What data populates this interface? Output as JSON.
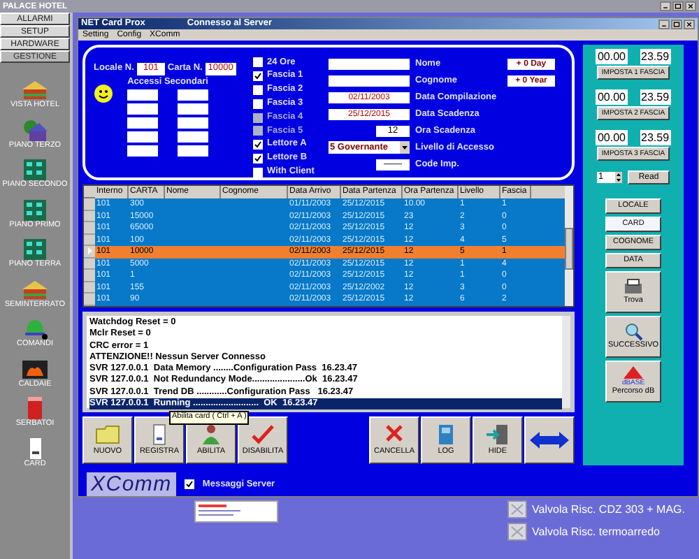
{
  "app_title": "PALACE HOTEL",
  "sidebar": {
    "tabs": [
      {
        "label": "ALLARMI",
        "selected": false
      },
      {
        "label": "SETUP",
        "selected": false
      },
      {
        "label": "HARDWARE",
        "selected": false
      },
      {
        "label": "GESTIONE",
        "selected": true
      }
    ],
    "items": [
      {
        "label": "VISTA HOTEL",
        "kind": "hotel"
      },
      {
        "label": "PIANO TERZO",
        "kind": "house"
      },
      {
        "label": "PIANO SECONDO",
        "kind": "building"
      },
      {
        "label": "PIANO PRIMO",
        "kind": "building"
      },
      {
        "label": "PIANO TERRA",
        "kind": "building"
      },
      {
        "label": "SEMINTERRATO",
        "kind": "hotel"
      },
      {
        "label": "COMANDI",
        "kind": "bell"
      },
      {
        "label": "CALDAIE",
        "kind": "fire"
      },
      {
        "label": "SERBATOI",
        "kind": "tank"
      },
      {
        "label": "CARD",
        "kind": "card"
      }
    ]
  },
  "window": {
    "title": "NET Card Prox",
    "status": "Connesso al Server",
    "menu": [
      "Setting",
      "Config",
      "XComm"
    ]
  },
  "form": {
    "locale_label": "Locale N.",
    "locale": "101",
    "carta_label": "Carta N.",
    "carta": "10000",
    "accessi_label": "Accessi Secondari",
    "checkboxes": [
      {
        "label": "24 Ore",
        "checked": false,
        "disabled": false
      },
      {
        "label": "Fascia 1",
        "checked": true,
        "disabled": false
      },
      {
        "label": "Fascia 2",
        "checked": false,
        "disabled": false
      },
      {
        "label": "Fascia 3",
        "checked": false,
        "disabled": false
      },
      {
        "label": "Fascia 4",
        "checked": false,
        "disabled": true
      },
      {
        "label": "Fascia 5",
        "checked": false,
        "disabled": true
      },
      {
        "label": "Lettore A",
        "checked": true,
        "disabled": false
      },
      {
        "label": "Lettore B",
        "checked": true,
        "disabled": false
      },
      {
        "label": "With Client",
        "checked": false,
        "disabled": false
      }
    ],
    "fields": [
      {
        "label": "Nome",
        "kind": "text",
        "button": "+ 0 Day"
      },
      {
        "label": "Cognome",
        "kind": "text",
        "button": "+ 0 Year"
      },
      {
        "label": "Data Compilazione",
        "kind": "text",
        "value": "02/11/2003"
      },
      {
        "label": "Data Scadenza",
        "kind": "text",
        "value": "25/12/2015"
      },
      {
        "label": "Ora Scadenza",
        "kind": "short",
        "value": "12"
      },
      {
        "label": "Livello di Accesso",
        "kind": "select",
        "value": "5 Governante"
      },
      {
        "label": "Code Imp.",
        "kind": "short",
        "value": "——"
      }
    ]
  },
  "table": {
    "columns": [
      "Interno",
      "CARTA",
      "Nome",
      "Cognome",
      "Data Arrivo",
      "Data Partenza",
      "Ora Partenza",
      "Livello",
      "Fascia"
    ],
    "rows": [
      {
        "selected": false,
        "cells": [
          "101",
          "300",
          "",
          "",
          "01/11/2003",
          "25/12/2015",
          "10.00",
          "1",
          "1"
        ]
      },
      {
        "selected": false,
        "cells": [
          "101",
          "15000",
          "",
          "",
          "02/11/2003",
          "25/12/2015",
          "23",
          "2",
          "0"
        ]
      },
      {
        "selected": false,
        "cells": [
          "101",
          "65000",
          "",
          "",
          "02/11/2003",
          "25/12/2015",
          "12",
          "3",
          "0"
        ]
      },
      {
        "selected": false,
        "cells": [
          "101",
          "100",
          "",
          "",
          "02/11/2003",
          "25/12/2015",
          "12",
          "4",
          "5"
        ]
      },
      {
        "selected": true,
        "cells": [
          "101",
          "10000",
          "",
          "",
          "02/11/2003",
          "25/12/2015",
          "12",
          "5",
          "1"
        ]
      },
      {
        "selected": false,
        "cells": [
          "101",
          "5000",
          "",
          "",
          "02/11/2003",
          "25/12/2015",
          "12",
          "1",
          "4"
        ]
      },
      {
        "selected": false,
        "cells": [
          "101",
          "1",
          "",
          "",
          "02/11/2003",
          "25/12/2015",
          "12",
          "1",
          "0"
        ]
      },
      {
        "selected": false,
        "cells": [
          "101",
          "155",
          "",
          "",
          "02/11/2003",
          "25/12/2002",
          "12",
          "3",
          "0"
        ]
      },
      {
        "selected": false,
        "cells": [
          "101",
          "90",
          "",
          "",
          "02/11/2003",
          "25/12/2015",
          "12",
          "6",
          "2"
        ]
      }
    ]
  },
  "log": [
    {
      "text": "Watchdog Reset = 0",
      "selected": false
    },
    {
      "text": "Mclr Reset = 0",
      "selected": false
    },
    {
      "text": "CRC error = 1",
      "selected": false
    },
    {
      "text": "ATTENZIONE!! Nessun Server Connesso",
      "selected": false
    },
    {
      "text": "SVR 127.0.0.1  Data Memory ........Configuration Pass  16.23.47",
      "selected": false
    },
    {
      "text": "SVR 127.0.0.1  Not Redundancy Mode.....................Ok  16.23.47",
      "selected": false
    },
    {
      "text": "SVR 127.0.0.1  Trend DB ............Configuration Pass   16.23.47",
      "selected": false
    },
    {
      "text": "SVR 127.0.0.1  Running ..........................  OK  16.23.47",
      "selected": true
    }
  ],
  "buttons_left": [
    {
      "label": "NUOVO",
      "kind": "folder"
    },
    {
      "label": "REGISTRA",
      "kind": "doc"
    },
    {
      "label": "ABILITA",
      "kind": "person"
    },
    {
      "label": "DISABILITA",
      "kind": "tick"
    }
  ],
  "buttons_right": [
    {
      "label": "CANCELLA",
      "kind": "cross"
    },
    {
      "label": "LOG",
      "kind": "book"
    },
    {
      "label": "HIDE",
      "kind": "door"
    },
    {
      "kind": "arrows"
    }
  ],
  "tooltip": "Abilita card ( Ctrl + A )",
  "logo": "XComm",
  "messaggi": {
    "label": "Messaggi Server",
    "checked": true
  },
  "fasce": [
    {
      "start": "00.00",
      "end": "23.59",
      "button": "IMPOSTA 1 FASCIA"
    },
    {
      "start": "00.00",
      "end": "23.59",
      "button": "IMPOSTA 2 FASCIA"
    },
    {
      "start": "00.00",
      "end": "23.59",
      "button": "IMPOSTA 3 FASCIA"
    }
  ],
  "reader": {
    "value": "1",
    "button": "Read"
  },
  "sort": [
    {
      "label": "LOCALE",
      "selected": false
    },
    {
      "label": "CARD",
      "selected": true
    },
    {
      "label": "COGNOME",
      "selected": false
    },
    {
      "label": "DATA",
      "selected": false
    }
  ],
  "actions": [
    {
      "label": "Trova",
      "kind": "search"
    },
    {
      "label": "SUCCESSIVO",
      "kind": "next"
    },
    {
      "label": "Percorso dB",
      "kind": "dbase",
      "tag": "dBASE"
    }
  ],
  "valves": [
    "Valvola Risc. CDZ 303 + MAG.",
    "Valvola Risc. termoarredo"
  ]
}
